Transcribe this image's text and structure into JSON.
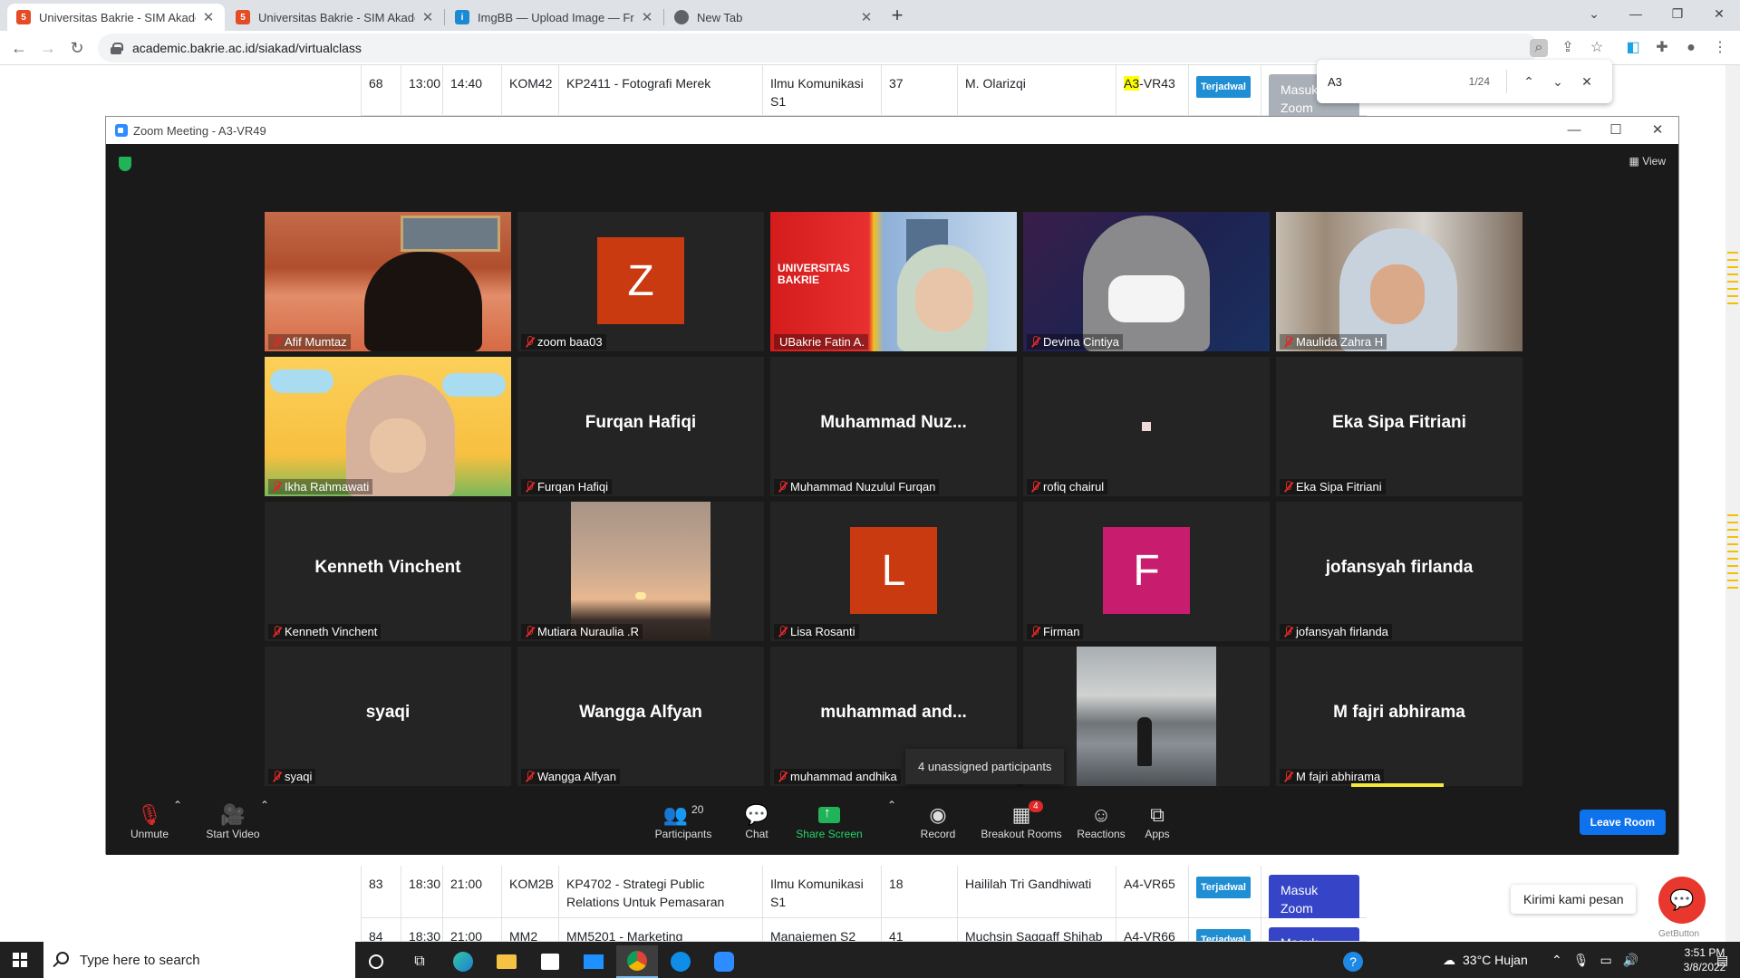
{
  "browser": {
    "tabs": [
      {
        "title": "Universitas Bakrie - SIM Akadem",
        "active": true
      },
      {
        "title": "Universitas Bakrie - SIM Akadem",
        "active": false
      },
      {
        "title": "ImgBB — Upload Image — Free",
        "active": false
      },
      {
        "title": "New Tab",
        "active": false
      }
    ],
    "url": "academic.bakrie.ac.id/siakad/virtualclass",
    "find": {
      "query": "A3",
      "count": "1/24"
    }
  },
  "table": {
    "rows": [
      {
        "no": "68",
        "start": "13:00",
        "end": "14:40",
        "kelas": "KOM42",
        "course": "KP2411 - Fotografi Merek",
        "prodi": "Ilmu Komunikasi S1",
        "students": "37",
        "lecturer": "M. Olarizqi",
        "room_hl": "A3",
        "room_rest": "-VR43",
        "status": "Terjadwal",
        "action": "Masuk Zoom"
      },
      {
        "no": "83",
        "start": "18:30",
        "end": "21:00",
        "kelas": "KOM2B",
        "course": "KP4702 - Strategi Public Relations Untuk Pemasaran",
        "prodi": "Ilmu Komunikasi S1",
        "students": "18",
        "lecturer": "Haililah Tri Gandhiwati",
        "room": "A4-VR65",
        "status": "Terjadwal",
        "action": "Masuk Zoom"
      },
      {
        "no": "84",
        "start": "18:30",
        "end": "21:00",
        "kelas": "MM2",
        "course": "MM5201 - Marketing",
        "prodi": "Manajemen S2",
        "students": "41",
        "lecturer": "Muchsin Saggaff Shihab /",
        "room": "A4-VR66",
        "status": "Terjadwal",
        "action": "Masuk Zoom"
      }
    ]
  },
  "chat_widget": {
    "bubble": "Kirimi kami pesan",
    "brand": "GetButton"
  },
  "zoom": {
    "window_title": "Zoom Meeting - A3-VR49",
    "view_label": "View",
    "tiles": [
      {
        "display": "",
        "name": "Afif Mumtaz",
        "kind": "video"
      },
      {
        "display": "Z",
        "name": "zoom baa03",
        "kind": "avatar",
        "color": "#c93a10"
      },
      {
        "display": "",
        "name": "UBakrie Fatin A.",
        "kind": "video",
        "active": true
      },
      {
        "display": "",
        "name": "Devina Cintiya",
        "kind": "video"
      },
      {
        "display": "",
        "name": "Maulida Zahra H",
        "kind": "video"
      },
      {
        "display": "",
        "name": "Ikha Rahmawati",
        "kind": "video"
      },
      {
        "display": "Furqan Hafiqi",
        "name": "Furqan Hafiqi",
        "kind": "text"
      },
      {
        "display": "Muhammad  Nuz...",
        "name": "Muhammad Nuzulul Furqan",
        "kind": "text"
      },
      {
        "display": "",
        "name": "rofiq chairul",
        "kind": "dot"
      },
      {
        "display": "Eka Sipa Fitriani",
        "name": "Eka Sipa Fitriani",
        "kind": "text"
      },
      {
        "display": "Kenneth Vinchent",
        "name": "Kenneth Vinchent",
        "kind": "text"
      },
      {
        "display": "",
        "name": "Mutiara Nuraulia .R",
        "kind": "photo"
      },
      {
        "display": "L",
        "name": "Lisa Rosanti",
        "kind": "avatar",
        "color": "#c93a10"
      },
      {
        "display": "F",
        "name": "Firman",
        "kind": "avatar",
        "color": "#c81d6e"
      },
      {
        "display": "jofansyah firlanda",
        "name": "jofansyah firlanda",
        "kind": "text"
      },
      {
        "display": "syaqi",
        "name": "syaqi",
        "kind": "text"
      },
      {
        "display": "Wangga Alfyan",
        "name": "Wangga Alfyan",
        "kind": "text"
      },
      {
        "display": "muhammad  and...",
        "name": "muhammad andhika",
        "kind": "text"
      },
      {
        "display": "",
        "name": "",
        "kind": "photo2"
      },
      {
        "display": "M fajri abhirama",
        "name": "M fajri abhirama",
        "kind": "text"
      }
    ],
    "tooltip": "4 unassigned participants",
    "toolbar": {
      "unmute": "Unmute",
      "start_video": "Start Video",
      "participants": "Participants",
      "participants_count": "20",
      "chat": "Chat",
      "share": "Share Screen",
      "record": "Record",
      "breakout": "Breakout Rooms",
      "breakout_badge": "4",
      "reactions": "Reactions",
      "apps": "Apps",
      "leave": "Leave Room"
    }
  },
  "taskbar": {
    "search_placeholder": "Type here to search",
    "weather": "33°C  Hujan",
    "time": "3:51 PM",
    "date": "3/8/2022"
  }
}
